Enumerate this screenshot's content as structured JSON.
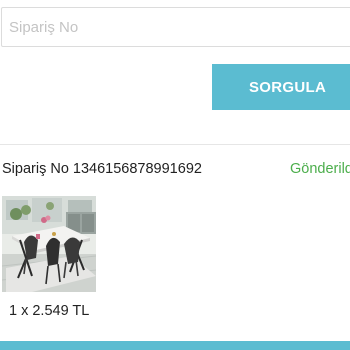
{
  "search": {
    "placeholder": "Sipariş No",
    "value": ""
  },
  "query_button": {
    "label": "SORGULA"
  },
  "order": {
    "number_text": "Sipariş No 1346156878991692",
    "status": "Gönderildi",
    "status_color": "#4cae4c",
    "items": [
      {
        "quantity_price": "1 x 2.549 TL"
      }
    ]
  },
  "colors": {
    "accent": "#5bbcd1"
  }
}
